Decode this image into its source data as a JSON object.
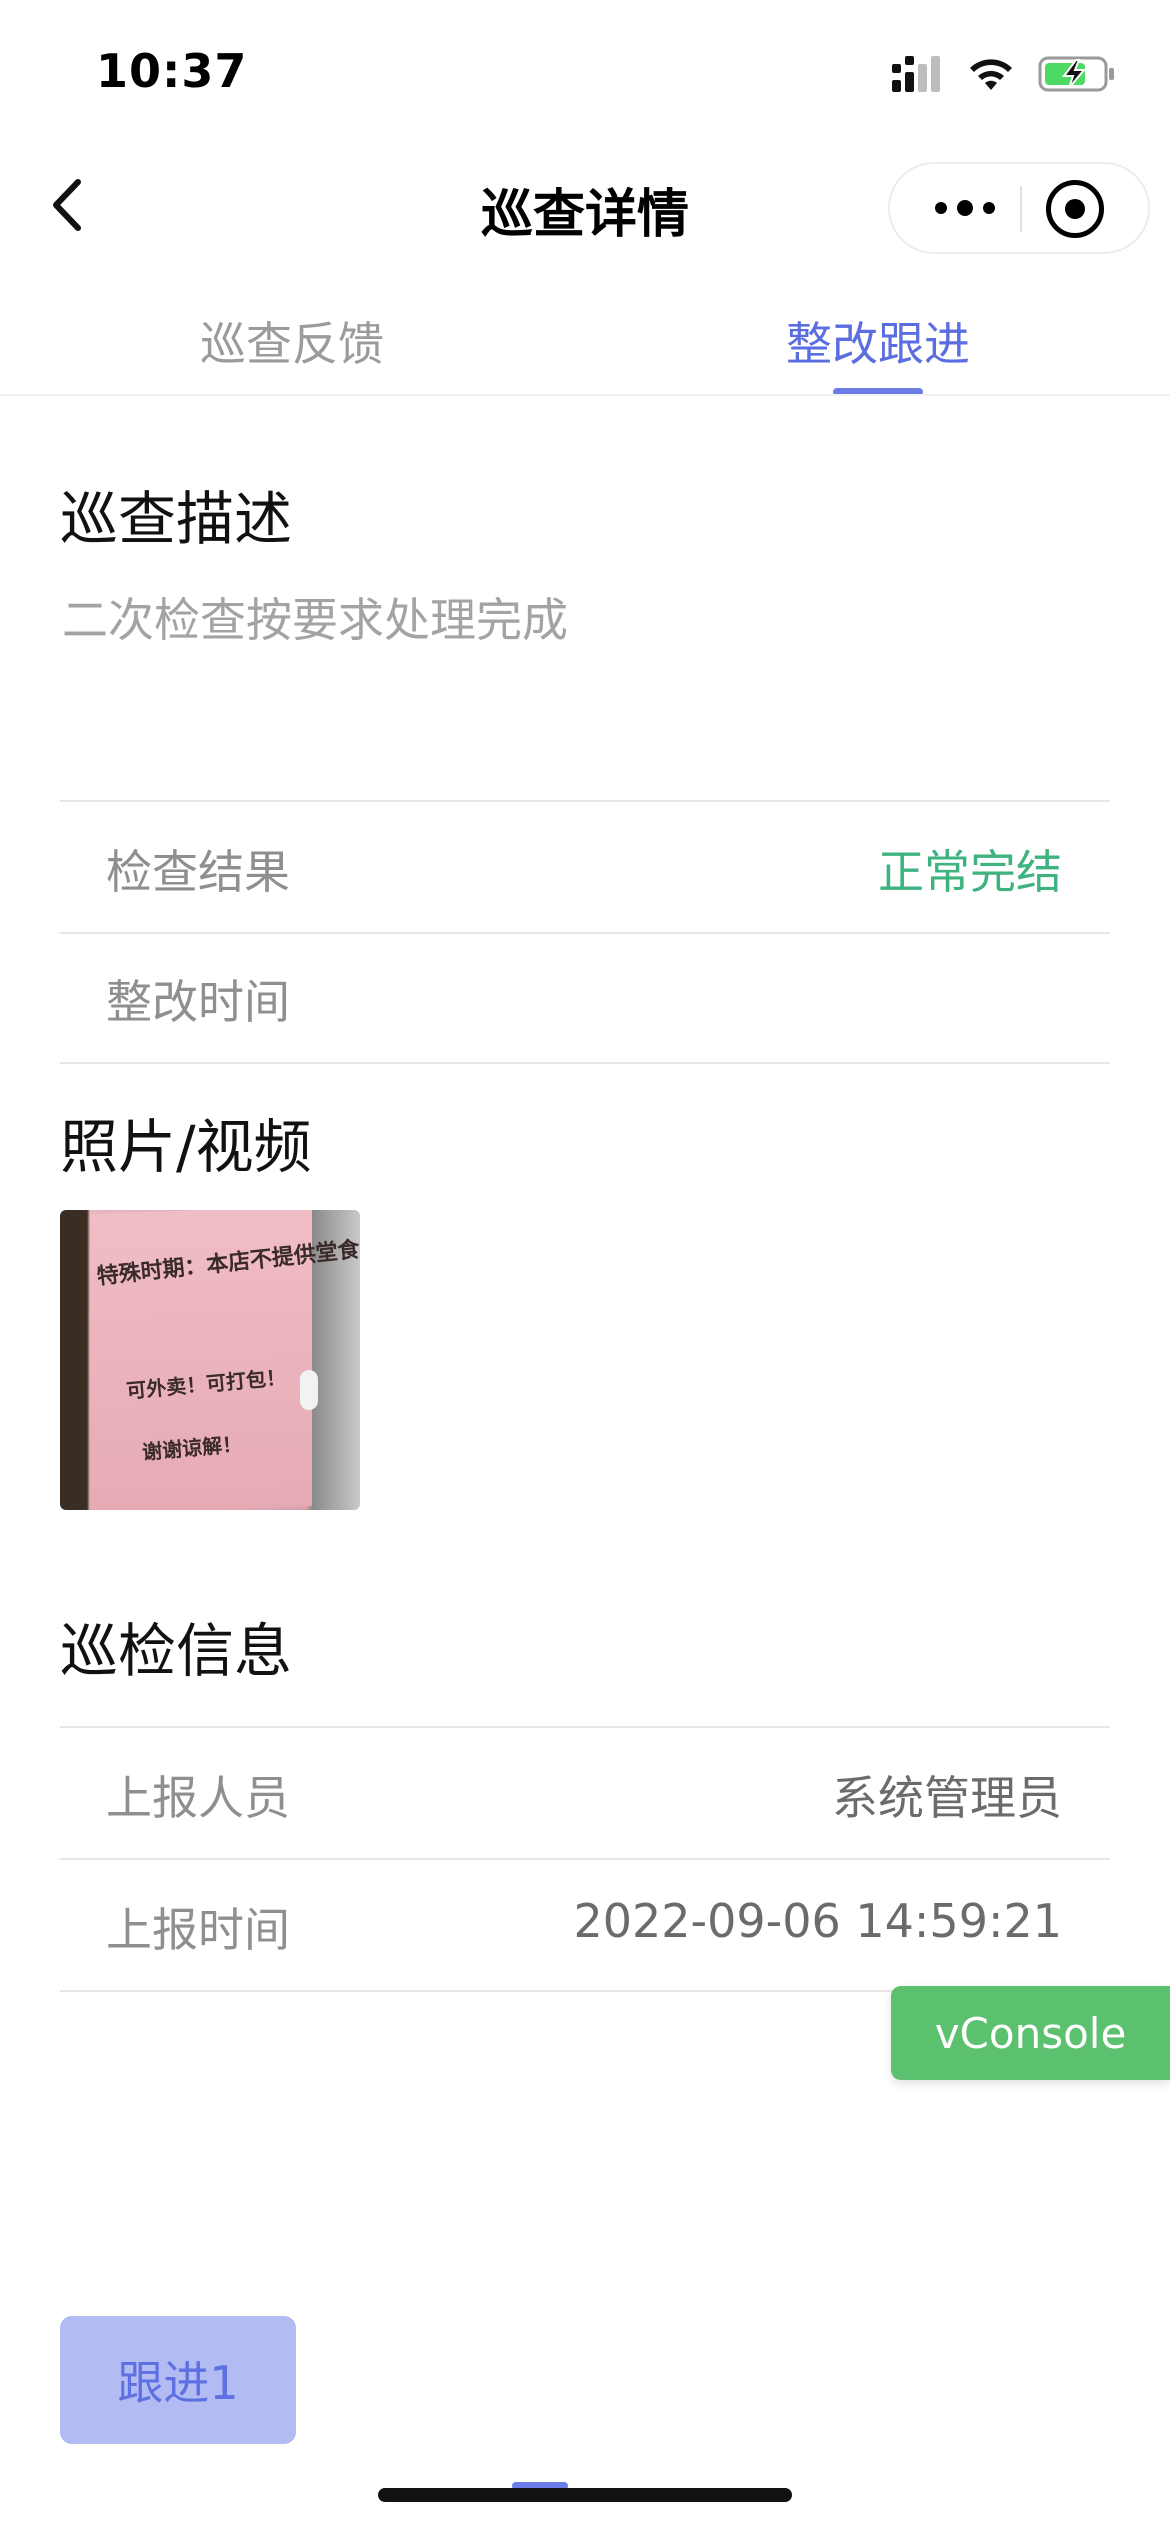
{
  "status_bar": {
    "time": "10:37",
    "icons": [
      "cellular-signal-icon",
      "wifi-icon",
      "battery-charging-icon"
    ]
  },
  "nav": {
    "title": "巡查详情",
    "back_icon": "chevron-left-icon",
    "more_icon": "more-dots-icon",
    "close_icon": "target-close-icon"
  },
  "tabs": [
    {
      "label": "巡查反馈",
      "active": false
    },
    {
      "label": "整改跟进",
      "active": true
    }
  ],
  "description": {
    "title": "巡查描述",
    "text": "二次检查按要求处理完成"
  },
  "result_rows": [
    {
      "label": "检查结果",
      "value": "正常完结",
      "value_color": "#3fb37f"
    },
    {
      "label": "整改时间",
      "value": ""
    }
  ],
  "media": {
    "title": "照片/视频",
    "photo_lines": [
      "特殊时期：本店不提供堂食！",
      "可外卖！可打包！",
      "谢谢谅解！"
    ]
  },
  "inspection_info": {
    "title": "巡检信息",
    "rows": [
      {
        "label": "上报人员",
        "value": "系统管理员"
      },
      {
        "label": "上报时间",
        "value": "2022-09-06 14:59:21"
      }
    ]
  },
  "vconsole_label": "vConsole",
  "follow_button_label": "跟进1",
  "colors": {
    "accent": "#5b6ee1",
    "success": "#3fb37f",
    "vconsole": "#5cc16e",
    "button_bg": "#b3bbf3"
  }
}
